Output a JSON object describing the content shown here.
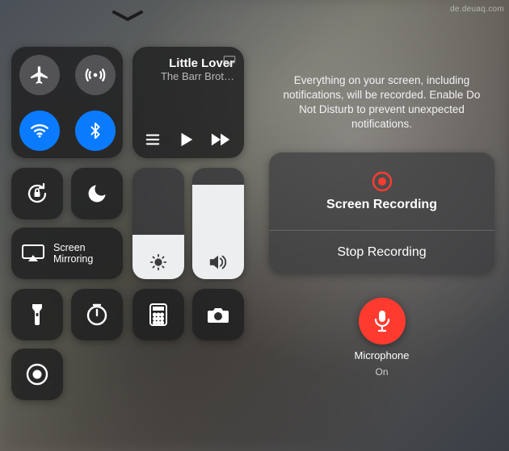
{
  "watermark": "de.deuaq.com",
  "control_center": {
    "connectivity": {
      "airplane_on": false,
      "cellular_on": false,
      "wifi_on": true,
      "bluetooth_on": true
    },
    "now_playing": {
      "title": "Little Lover",
      "artist": "The Barr Brot…",
      "airplay_icon": "airplay-icon",
      "playlist_icon": "list-icon",
      "play_icon": "play-icon",
      "forward_icon": "forward-icon"
    },
    "orientation_lock": {
      "icon": "orientation-lock-icon"
    },
    "do_not_disturb": {
      "icon": "moon-icon"
    },
    "screen_mirroring": {
      "label1": "Screen",
      "label2": "Mirroring",
      "icon": "screen-mirror-icon"
    },
    "brightness": {
      "level_pct": 40,
      "icon": "sun-icon"
    },
    "volume": {
      "level_pct": 85,
      "icon": "speaker-icon"
    },
    "flashlight": {
      "icon": "flashlight-icon"
    },
    "timer": {
      "icon": "timer-icon"
    },
    "calculator": {
      "icon": "calculator-icon"
    },
    "camera": {
      "icon": "camera-icon"
    },
    "screen_record": {
      "icon": "record-icon"
    }
  },
  "record_sheet": {
    "info": "Everything on your screen, including notifications, will be recorded. Enable Do Not Disturb to prevent unexpected notifications.",
    "primary_label": "Screen Recording",
    "stop_label": "Stop Recording",
    "mic_label": "Microphone",
    "mic_state": "On",
    "accent": "#ff3b30"
  }
}
